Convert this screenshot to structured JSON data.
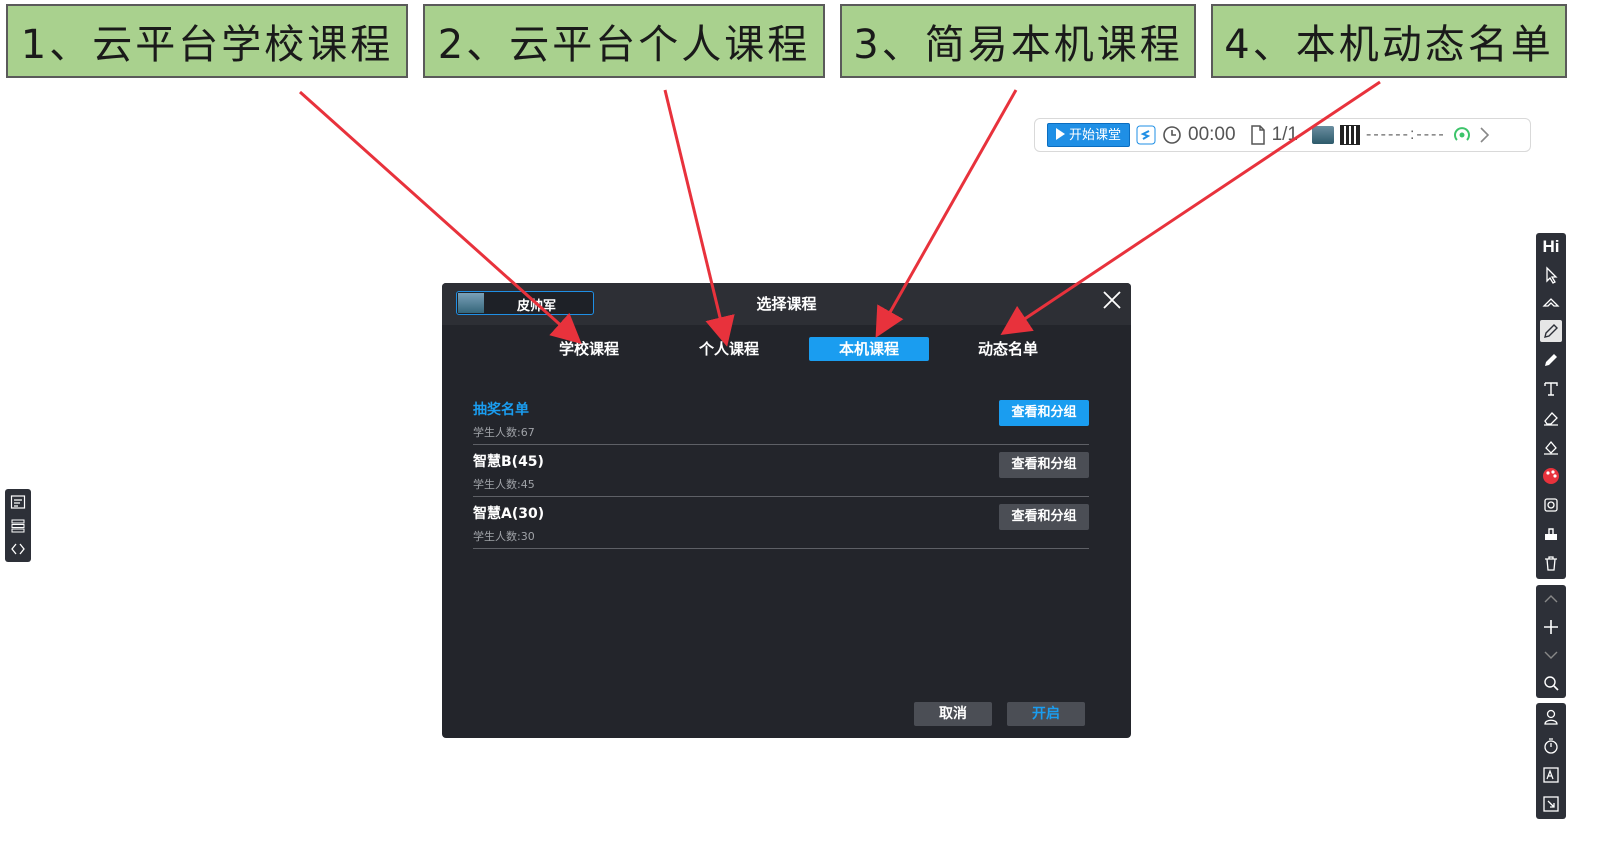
{
  "callouts": [
    {
      "label": "1、云平台学校课程"
    },
    {
      "label": "2、云平台个人课程"
    },
    {
      "label": "3、简易本机课程"
    },
    {
      "label": "4、本机动态名单"
    }
  ],
  "topbar": {
    "start_label": "开始课堂",
    "timer": "00:00",
    "page_counter": "1/1",
    "connection": "------:----"
  },
  "dialog": {
    "user_name": "皮帅军",
    "title": "选择课程",
    "tabs": [
      {
        "label": "学校课程",
        "active": false
      },
      {
        "label": "个人课程",
        "active": false
      },
      {
        "label": "本机课程",
        "active": true
      },
      {
        "label": "动态名单",
        "active": false
      }
    ],
    "rows": [
      {
        "name": "抽奖名单",
        "sub": "学生人数:67",
        "button": "查看和分组",
        "highlighted": true
      },
      {
        "name": "智慧B(45)",
        "sub": "学生人数:45",
        "button": "查看和分组",
        "highlighted": false
      },
      {
        "name": "智慧A(30)",
        "sub": "学生人数:30",
        "button": "查看和分组",
        "highlighted": false
      }
    ],
    "cancel_label": "取消",
    "open_label": "开启"
  },
  "right_toolbar": {
    "hi_label": "Hi"
  },
  "colors": {
    "callout_bg": "#a9d18e",
    "accent": "#1a9df0",
    "arrow": "#e8323c",
    "dialog_bg": "#23252b"
  }
}
